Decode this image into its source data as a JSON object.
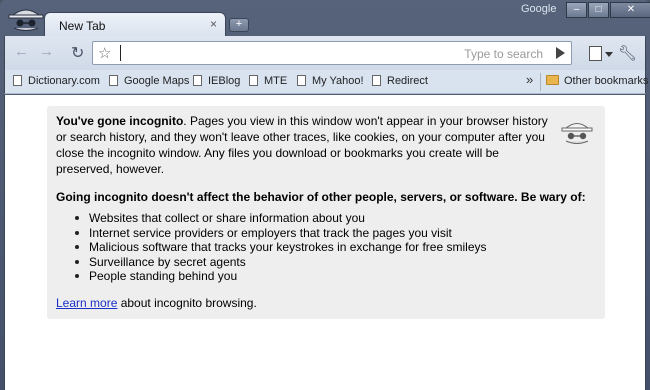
{
  "window": {
    "brand": "Google",
    "minimize_icon": "minimize-icon",
    "maximize_icon": "maximize-icon",
    "close_icon": "close-icon"
  },
  "tabs": [
    {
      "title": "New Tab",
      "close": "×"
    }
  ],
  "new_tab_label": "+",
  "toolbar": {
    "omnibox_value": "",
    "omnibox_placeholder": "Type to search"
  },
  "bookmarks": {
    "items": [
      {
        "label": "Dictionary.com"
      },
      {
        "label": "Google Maps"
      },
      {
        "label": "IEBlog"
      },
      {
        "label": "MTE"
      },
      {
        "label": "My Yahoo!"
      },
      {
        "label": "Redirect"
      }
    ],
    "overflow": "»",
    "other": "Other bookmarks"
  },
  "incognito": {
    "intro_bold": "You've gone incognito",
    "intro_text": ". Pages you view in this window won't appear in your browser history or search history, and they won't leave other traces, like cookies, on your computer after you close the incognito window. Any files you download or bookmarks you create will be preserved, however.",
    "heading": "Going incognito doesn't affect the behavior of other people, servers, or software. Be wary of:",
    "list": [
      "Websites that collect or share information about you",
      "Internet service providers or employers that track the pages you visit",
      "Malicious software that tracks your keystrokes in exchange for free smileys",
      "Surveillance by secret agents",
      "People standing behind you"
    ],
    "learn_more": "Learn more",
    "learn_more_suffix": " about incognito browsing."
  },
  "colors": {
    "frame": "#4a5566",
    "toolbar": "#d9e2ef",
    "link": "#1a30c8",
    "notice_bg": "#eeeeee"
  }
}
